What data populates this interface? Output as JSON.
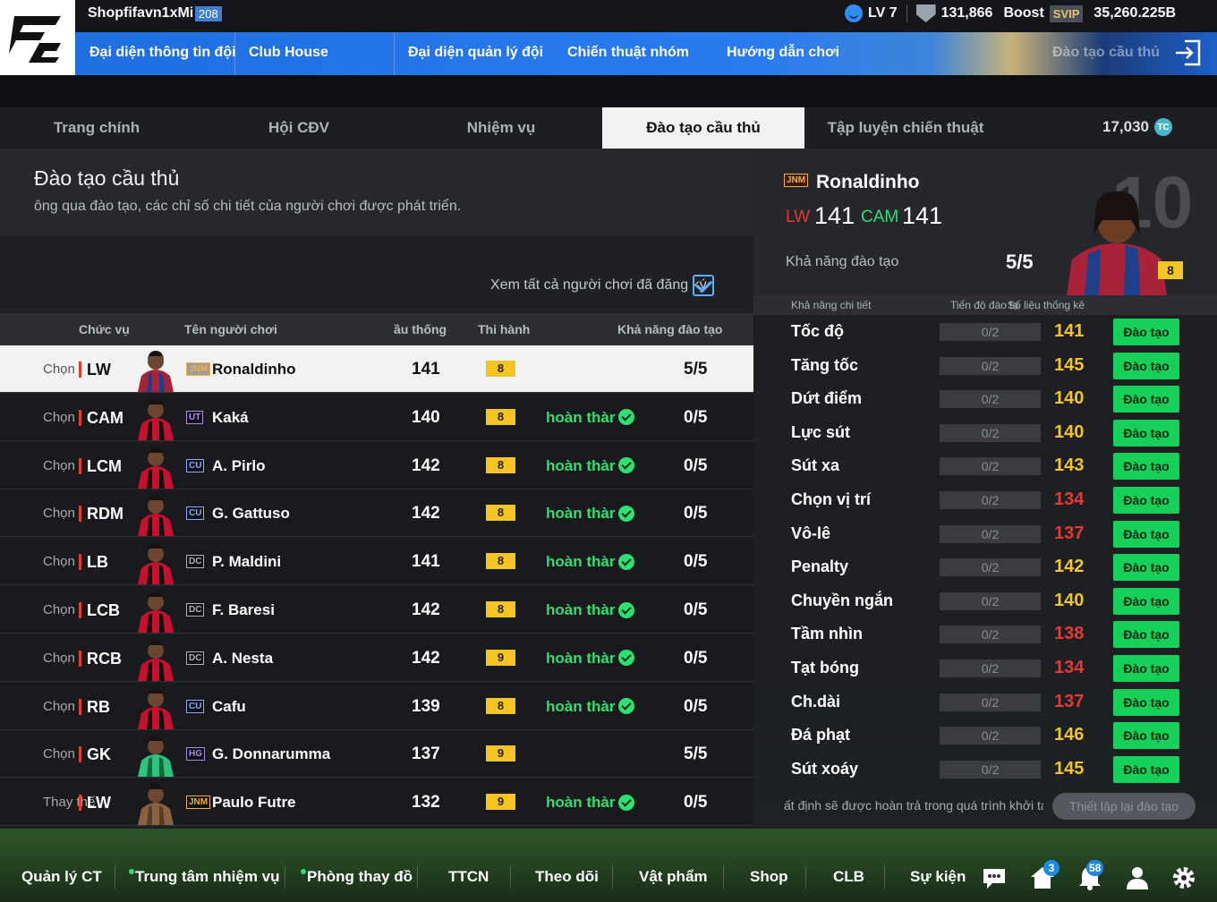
{
  "header": {
    "username": "Shopfifavn1xMi",
    "user_level": "208",
    "lv_label": "LV 7",
    "points": "131,866",
    "boost_label": "Boost",
    "svip_label": "SVIP",
    "balance": "35,260.225B"
  },
  "nav": {
    "items": [
      "Đại diện thông tin đội",
      "Club House",
      "Đại diện quản lý đội",
      "Chiến thuật nhóm",
      "Hướng dẫn chơi",
      "Đào tạo cầu thủ"
    ]
  },
  "tabs": {
    "items": [
      "Trang chính",
      "Hội CĐV",
      "Nhiệm vụ",
      "Đào tạo cầu thủ",
      "Tập luyện chiến thuật"
    ],
    "active_index": 3,
    "coins": "17,030",
    "coin_icon_text": "TC"
  },
  "training": {
    "title": "Đào tạo cầu thủ",
    "subtitle": "ông qua đào tạo, các chỉ số chi tiết của người chơi được phát triển.",
    "view_all_label": "Xem tất cả người chơi đã đăng ký",
    "view_all_checked": true,
    "columns": [
      "Chức vụ",
      "Tên người chơi",
      "ầu thống",
      "Thi hành",
      "Khả năng đào tạo"
    ],
    "players": [
      {
        "choose": "Chọn",
        "pos": "LW",
        "season": "JNM",
        "season_color": "#f0b04a",
        "name": "Ronaldinho",
        "ovr": "141",
        "level": "8",
        "status": "",
        "train": "5/5",
        "selected": true,
        "kit": "barca"
      },
      {
        "choose": "Chọn",
        "pos": "CAM",
        "season": "UT",
        "season_color": "#b38cf0",
        "name": "Kaká",
        "ovr": "140",
        "level": "8",
        "status": "hoàn thàr",
        "train": "0/5",
        "selected": false,
        "kit": "milan"
      },
      {
        "choose": "Chọn",
        "pos": "LCM",
        "season": "CU",
        "season_color": "#8fa8ff",
        "name": "A. Pirlo",
        "ovr": "142",
        "level": "8",
        "status": "hoàn thàr",
        "train": "0/5",
        "selected": false,
        "kit": "milan"
      },
      {
        "choose": "Chọn",
        "pos": "RDM",
        "season": "CU",
        "season_color": "#8fa8ff",
        "name": "G. Gattuso",
        "ovr": "142",
        "level": "8",
        "status": "hoàn thàr",
        "train": "0/5",
        "selected": false,
        "kit": "milan"
      },
      {
        "choose": "Chọn",
        "pos": "LB",
        "season": "DC",
        "season_color": "#b0b0b0",
        "name": "P. Maldini",
        "ovr": "141",
        "level": "8",
        "status": "hoàn thàr",
        "train": "0/5",
        "selected": false,
        "kit": "milan"
      },
      {
        "choose": "Chọn",
        "pos": "LCB",
        "season": "DC",
        "season_color": "#b0b0b0",
        "name": "F. Baresi",
        "ovr": "142",
        "level": "8",
        "status": "hoàn thàr",
        "train": "0/5",
        "selected": false,
        "kit": "milan"
      },
      {
        "choose": "Chọn",
        "pos": "RCB",
        "season": "DC",
        "season_color": "#b0b0b0",
        "name": "A. Nesta",
        "ovr": "142",
        "level": "9",
        "status": "hoàn thàr",
        "train": "0/5",
        "selected": false,
        "kit": "milan"
      },
      {
        "choose": "Chọn",
        "pos": "RB",
        "season": "CU",
        "season_color": "#8fa8ff",
        "name": "Cafu",
        "ovr": "139",
        "level": "8",
        "status": "hoàn thàr",
        "train": "0/5",
        "selected": false,
        "kit": "milan"
      },
      {
        "choose": "Chọn",
        "pos": "GK",
        "season": "HG",
        "season_color": "#a890e0",
        "name": "G. Donnarumma",
        "ovr": "137",
        "level": "9",
        "status": "",
        "train": "5/5",
        "selected": false,
        "kit": "gk"
      },
      {
        "choose": "Thay thế",
        "pos": "LW",
        "season": "JNM",
        "season_color": "#f0b04a",
        "name": "Paulo Futre",
        "ovr": "132",
        "level": "9",
        "status": "hoàn thàr",
        "train": "0/5",
        "selected": false,
        "kit": "skin"
      }
    ]
  },
  "detail": {
    "season": "JNM",
    "name": "Ronaldinho",
    "pos1": "LW",
    "val1": "141",
    "pos2": "CAM",
    "val2": "141",
    "train_label": "Khả năng đào tạo",
    "train_value": "5/5",
    "number": "10",
    "level": "8",
    "stat_headers": [
      "Khả năng chi tiết",
      "Tiến độ đào tạ",
      "Số liệu thống kê"
    ],
    "stats": [
      {
        "name": "Tốc độ",
        "progress": "0/2",
        "value": "141",
        "color": "#f2c525",
        "button": "Đào tạo"
      },
      {
        "name": "Tăng tốc",
        "progress": "0/2",
        "value": "145",
        "color": "#f2c525",
        "button": "Đào tạo"
      },
      {
        "name": "Dứt điểm",
        "progress": "0/2",
        "value": "140",
        "color": "#f2c525",
        "button": "Đào tạo"
      },
      {
        "name": "Lực sút",
        "progress": "0/2",
        "value": "140",
        "color": "#f2c525",
        "button": "Đào tạo"
      },
      {
        "name": "Sút xa",
        "progress": "0/2",
        "value": "143",
        "color": "#f2c525",
        "button": "Đào tạo"
      },
      {
        "name": "Chọn vị trí",
        "progress": "0/2",
        "value": "134",
        "color": "#e53935",
        "button": "Đào tạo"
      },
      {
        "name": "Vô-lê",
        "progress": "0/2",
        "value": "137",
        "color": "#e53935",
        "button": "Đào tạo"
      },
      {
        "name": "Penalty",
        "progress": "0/2",
        "value": "142",
        "color": "#f2c525",
        "button": "Đào tạo"
      },
      {
        "name": "Chuyền ngắn",
        "progress": "0/2",
        "value": "140",
        "color": "#f2c525",
        "button": "Đào tạo"
      },
      {
        "name": "Tầm nhìn",
        "progress": "0/2",
        "value": "138",
        "color": "#e53935",
        "button": "Đào tạo"
      },
      {
        "name": "Tạt bóng",
        "progress": "0/2",
        "value": "134",
        "color": "#e53935",
        "button": "Đào tạo"
      },
      {
        "name": "Ch.dài",
        "progress": "0/2",
        "value": "137",
        "color": "#e53935",
        "button": "Đào tạo"
      },
      {
        "name": "Đá phạt",
        "progress": "0/2",
        "value": "146",
        "color": "#f2c525",
        "button": "Đào tạo"
      },
      {
        "name": "Sút xoáy",
        "progress": "0/2",
        "value": "145",
        "color": "#f2c525",
        "button": "Đào tạo"
      }
    ],
    "note": "ất định sẽ được hoàn trả trong quá trình khởi tạ",
    "reset_label": "Thiết lập lại đào tạo"
  },
  "bottom": {
    "items": [
      "Quản lý CT",
      "Trung tâm nhiệm vụ",
      "Phòng thay đồ",
      "TTCN",
      "Theo dõi",
      "Vật phẩm",
      "Shop",
      "CLB",
      "Sự kiện"
    ],
    "home_badge": "3",
    "bell_badge": "58"
  }
}
